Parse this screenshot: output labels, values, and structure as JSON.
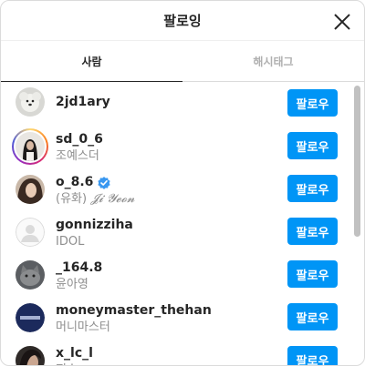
{
  "header": {
    "title": "팔로잉"
  },
  "tabs": [
    {
      "label": "사람",
      "active": true
    },
    {
      "label": "해시태그",
      "active": false
    }
  ],
  "colors": {
    "accent": "#0095f6",
    "verified": "#3897f0"
  },
  "users": [
    {
      "username": "2jd1ary",
      "fullname": "",
      "button": "팔로우",
      "verified": false
    },
    {
      "username": "sd_0_6",
      "fullname": "조예스더",
      "button": "팔로우",
      "verified": false
    },
    {
      "username": "o_8.6",
      "fullname": "(유화)",
      "fullname_fancy": "𝓙𝓲 𝓨𝓮𝓸𝓷",
      "button": "팔로우",
      "verified": true
    },
    {
      "username": "gonnizziha",
      "fullname": "IDOL",
      "button": "팔로우",
      "verified": false
    },
    {
      "username": "_164.8",
      "fullname": "윤아영",
      "button": "팔로우",
      "verified": false
    },
    {
      "username": "moneymaster_thehan",
      "fullname": "머니마스터",
      "button": "팔로우",
      "verified": false
    },
    {
      "username": "x_lc_l",
      "fullname": "지수",
      "button": "팔로우",
      "verified": false
    }
  ]
}
